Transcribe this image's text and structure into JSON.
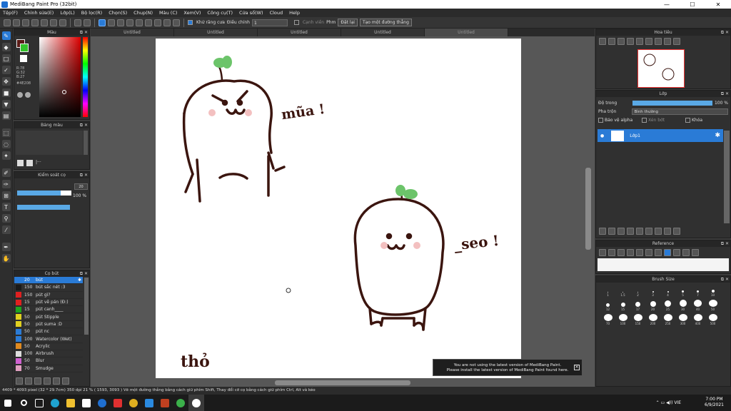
{
  "window": {
    "title": "MediBang Paint Pro (32bit)",
    "controls": [
      "—",
      "☐",
      "✕"
    ]
  },
  "menu": [
    "Tệp(F)",
    "Chỉnh sửa(E)",
    "Lớp(L)",
    "Bộ lọc(R)",
    "Chọn(S)",
    "Chup(N)",
    "Màu (C)",
    "Xem(V)",
    "Công cụ(T)",
    "Cửa sổ(W)",
    "Cloud",
    "Help"
  ],
  "toolbar": {
    "antialias_label": "Khử răng cưa",
    "correction_label": "Điều chỉnh",
    "correction_value": "1",
    "canvas_edge_label": "Cạnh viền",
    "fill_label": "Phm",
    "cancel_label": "Đặt lại",
    "create_line_label": "Tạo một đường thẳng"
  },
  "tabs": [
    "Untitled",
    "Untitled",
    "Untitled",
    "Untitled",
    "Untitled"
  ],
  "color_panel": {
    "title": "Màu",
    "rgb": [
      "R:78",
      "G:32",
      "B:27"
    ],
    "hex": "#4E208",
    "fg_color": "#5a1b16",
    "bg_color": "#33c42b"
  },
  "swatch_panel": {
    "title": "Bảng màu"
  },
  "brush_control": {
    "title": "Kiểm soát cọ",
    "size_value": "20",
    "opacity_value": "100 %",
    "size_fraction": 0.8
  },
  "brush_panel": {
    "title": "Cọ bút",
    "brushes": [
      {
        "size": "20",
        "name": "bút",
        "color": "#2a7bd6",
        "selected": true
      },
      {
        "size": "150",
        "name": "bút sắc nét :3",
        "color": "#1a1a1a"
      },
      {
        "size": "150",
        "name": "pút gì?",
        "color": "#e02020"
      },
      {
        "size": "15",
        "name": "pút vẽ pán (Đ:)",
        "color": "#e02020"
      },
      {
        "size": "15",
        "name": "pút canh____",
        "color": "#1fa51f"
      },
      {
        "size": "50",
        "name": "pút Stipple",
        "color": "#e0d020"
      },
      {
        "size": "50",
        "name": "pút suma :D",
        "color": "#e0d020"
      },
      {
        "size": "50",
        "name": "pút nc",
        "color": "#2a7bd6"
      },
      {
        "size": "100",
        "name": "Watercolor (Wet)",
        "color": "#2a7bd6"
      },
      {
        "size": "50",
        "name": "Acrylic",
        "color": "#e08a20"
      },
      {
        "size": "100",
        "name": "Airbrush",
        "color": "#dddddd"
      },
      {
        "size": "50",
        "name": "Blur",
        "color": "#d060d0"
      },
      {
        "size": "70",
        "name": "Smudge",
        "color": "#e0a0c0"
      }
    ]
  },
  "canvas": {
    "labels": [
      "mũa !",
      "_seo !",
      "thỏ"
    ]
  },
  "notice": {
    "line1": "You are not using the latest version of MediBang Paint.",
    "line2": "Please install the latest version of MediBang Paint found here."
  },
  "navigator": {
    "title": "Hoa tiêu"
  },
  "layer_panel": {
    "title": "Lớp",
    "opacity_label": "Độ trong",
    "opacity_value": "100 %",
    "blend_label": "Pha trộn",
    "blend_value": "Bình thường",
    "protect_alpha_label": "Bảo vệ alpha",
    "clipping_label": "Xén bớt",
    "lock_label": "Khóa",
    "layer_name": "Lớp1"
  },
  "reference": {
    "title": "Reference"
  },
  "brush_size": {
    "title": "Brush Size",
    "row1": [
      "1",
      "1.5",
      "2",
      "3",
      "4",
      "5",
      "7",
      "10"
    ],
    "row2": [
      "12",
      "15",
      "17",
      "20",
      "25",
      "30",
      "40",
      "50"
    ],
    "row3": [
      "70",
      "100",
      "150",
      "200",
      "250",
      "300",
      "400",
      "500"
    ]
  },
  "status": {
    "text": "4409 * 4093 pixel  (32 * 29.7cm)  350 dpi  21 %  ( 1593, 3093 )  Vẽ một đường thẳng bằng cách giữ phím Shift, Thay đổi cỡ cọ bằng cách giữ phím Ctrl, Alt và kéo"
  },
  "taskbar": {
    "time": "7:00 PM",
    "date": "6/9/2021",
    "lang": "VIE"
  }
}
